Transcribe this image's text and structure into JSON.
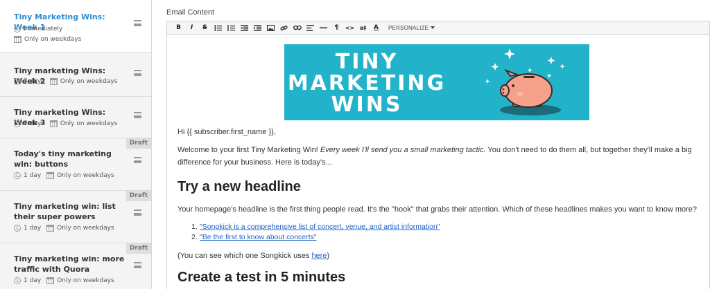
{
  "sidebar": {
    "items": [
      {
        "title": "Tiny Marketing Wins: Week 1",
        "delay": "Immediately",
        "schedule": "Only on weekdays",
        "draft": false
      },
      {
        "title": "Tiny marketing Wins: Week 2",
        "delay": "7 days",
        "schedule": "Only on weekdays",
        "draft": false
      },
      {
        "title": "Tiny marketing Wins: Week 3",
        "delay": "7 days",
        "schedule": "Only on weekdays",
        "draft": false
      },
      {
        "title": "Today's tiny marketing win: buttons",
        "delay": "1 day",
        "schedule": "Only on weekdays",
        "draft": true
      },
      {
        "title": "Tiny marketing win: list their super powers",
        "delay": "1 day",
        "schedule": "Only on weekdays",
        "draft": true
      },
      {
        "title": "Tiny marketing win: more traffic with Quora",
        "delay": "1 day",
        "schedule": "Only on weekdays",
        "draft": true
      }
    ],
    "draft_label": "Draft"
  },
  "editor": {
    "label": "Email Content",
    "toolbar": {
      "bold": "B",
      "italic": "I",
      "strike": "S",
      "paragraph": "¶",
      "code": "<>",
      "clear": "a‡",
      "color": "A",
      "personalize": "PERSONALIZE"
    },
    "banner": {
      "line1": "TINY",
      "line2": "MARKETING",
      "line3": "WINS",
      "bg_color": "#22b2c9"
    },
    "greeting": "Hi {{ subscriber.first_name }},",
    "intro_1": "Welcome to your first Tiny Marketing Win! ",
    "intro_em": "Every week I'll send you a small marketing tactic.",
    "intro_2": " You don't need to do them all, but together they'll make a big difference for your business. Here is today's...",
    "heading_1": "Try a new headline",
    "para_1": "Your homepage's headline is the first thing people read. It's the \"hook\" that grabs their attention. Which of these headlines makes you want to know more?",
    "list": [
      {
        "num": "1.",
        "text": "\"Songkick is a comprehensive list of concert, venue, and artist information\""
      },
      {
        "num": "2.",
        "text": "\"Be the first to know about concerts\""
      }
    ],
    "para_2_before": "(You can see which one Songkick uses ",
    "para_2_link": "here",
    "para_2_after": ")",
    "heading_2": "Create a test in 5 minutes"
  }
}
